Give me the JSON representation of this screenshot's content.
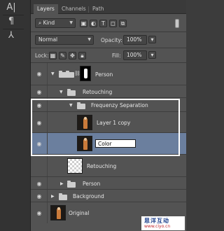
{
  "toolbar": {
    "tools": [
      {
        "icon": "type-tool-icon",
        "glyph": "A|"
      },
      {
        "icon": "paragraph-icon",
        "glyph": "¶"
      },
      {
        "icon": "tool-presets-icon",
        "glyph": "⅄"
      }
    ]
  },
  "tabs": [
    {
      "label": "Layers",
      "active": true
    },
    {
      "label": "Channels",
      "active": false
    },
    {
      "label": "Path",
      "active": false
    }
  ],
  "filter": {
    "kind_label": "Kind",
    "search_glyph": "⌕",
    "icons": [
      "image-filter-icon",
      "adjustment-filter-icon",
      "type-filter-icon",
      "shape-filter-icon",
      "smart-object-filter-icon"
    ]
  },
  "blend": {
    "mode": "Normal",
    "opacity_label": "Opacity:",
    "opacity_value": "100%"
  },
  "lock": {
    "label": "Lock:",
    "fill_label": "Fill:",
    "fill_value": "100%"
  },
  "layers": [
    {
      "name": "Person",
      "kind": "group-mask",
      "expanded": true,
      "indent": 0
    },
    {
      "name": "Retouching",
      "kind": "group",
      "expanded": true,
      "indent": 1
    },
    {
      "name": "Frequenzy Separation",
      "kind": "group",
      "expanded": true,
      "indent": 2
    },
    {
      "name": "Layer 1 copy",
      "kind": "image",
      "indent": 3
    },
    {
      "name": "Color",
      "kind": "image-editing",
      "indent": 3,
      "selected": true
    },
    {
      "name": "Retouching",
      "kind": "empty",
      "indent": 2
    },
    {
      "name": "Person",
      "kind": "group",
      "expanded": false,
      "indent": 1
    },
    {
      "name": "Background",
      "kind": "group",
      "expanded": false,
      "indent": 0
    },
    {
      "name": "Original",
      "kind": "image",
      "indent": 0
    }
  ],
  "watermark": {
    "title": "思洋互动",
    "url": "www.ciyo.cn"
  },
  "colors": {
    "panel": "#535353",
    "selection": "#6b7f9e",
    "highlight_border": "#ffffff"
  }
}
